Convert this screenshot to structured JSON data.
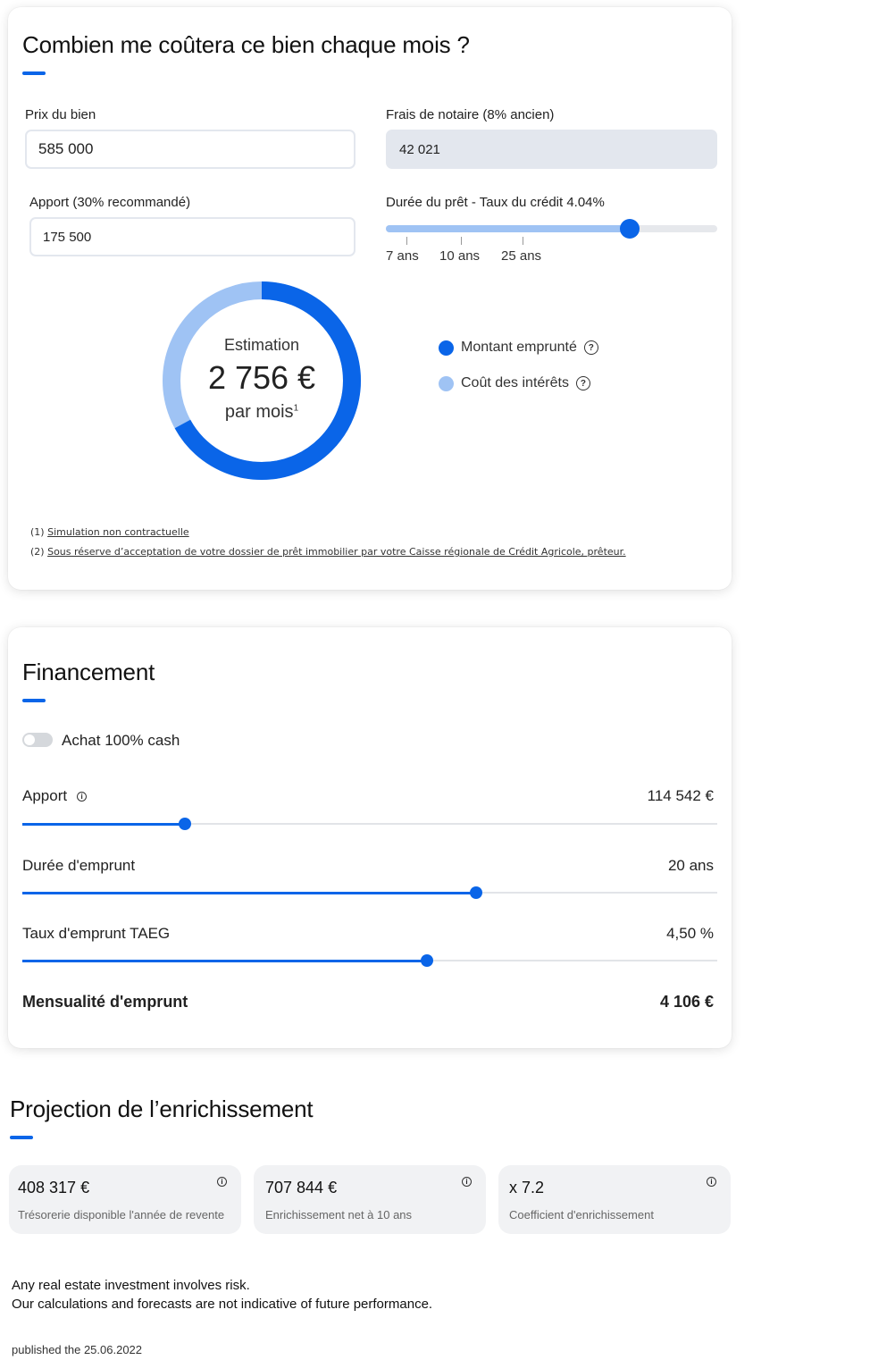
{
  "cost": {
    "title": "Combien me coûtera ce bien chaque mois ?",
    "price_label": "Prix du bien",
    "price_value": "585 000",
    "notary_label": "Frais de notaire (8% ancien)",
    "notary_value": "42 021",
    "down_label": "Apport (30% recommandé)",
    "down_value": "175 500",
    "loan_label": "Durée du prêt - Taux du crédit 4.04%",
    "loan_slider_fraction": 0.735,
    "loan_ticks": [
      "7 ans",
      "10 ans",
      "25 ans"
    ],
    "estimation_label": "Estimation",
    "estimation_value": "2 756 €",
    "per_month": "par mois",
    "per_month_sup": "1",
    "donut_interest_fraction": 0.33,
    "legend": [
      {
        "label": "Montant emprunté",
        "color": "#0a65e8"
      },
      {
        "label": "Coût des intérêts",
        "color": "#9fc3f4"
      }
    ],
    "footnote1_num": "(1)",
    "footnote1_text": "Simulation non contractuelle",
    "footnote2_num": "(2)",
    "footnote2_text": "Sous réserve d’acceptation de votre dossier de prêt immobilier par votre Caisse régionale de Crédit Agricole, prêteur."
  },
  "financing": {
    "title": "Financement",
    "cash_toggle_label": "Achat 100% cash",
    "cash_toggle_on": false,
    "rows": [
      {
        "label": "Apport",
        "value": "114 542 €",
        "fraction": 0.234
      },
      {
        "label": "Durée d'emprunt",
        "value": "20 ans",
        "fraction": 0.653
      },
      {
        "label": "Taux d'emprunt TAEG",
        "value": "4,50 %",
        "fraction": 0.582
      }
    ],
    "monthly_label": "Mensualité d'emprunt",
    "monthly_value": "4 106 €"
  },
  "projection": {
    "title": "Projection de l’enrichissement",
    "cards": [
      {
        "value": "408 317 €",
        "desc": "Trésorerie disponible l'année de revente"
      },
      {
        "value": "707 844 €",
        "desc": "Enrichissement net à 10 ans"
      },
      {
        "value": "x 7.2",
        "desc": "Coefficient d'enrichissement"
      }
    ]
  },
  "disclaimer": {
    "line1": "Any real estate investment involves risk.",
    "line2": "Our calculations and forecasts are not indicative of future performance.",
    "published": "published the 25.06.2022"
  },
  "colors": {
    "accent": "#0a65e8",
    "accent_light": "#9fc3f4"
  }
}
